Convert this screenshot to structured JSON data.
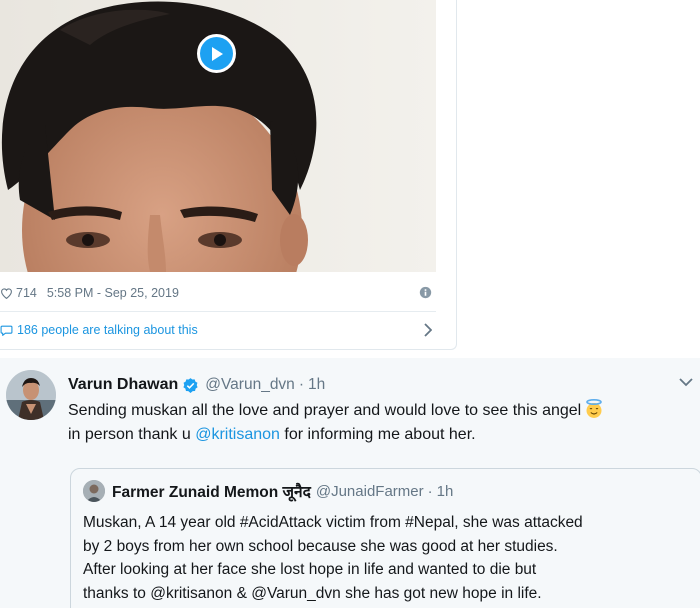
{
  "embed": {
    "likes": "714",
    "timestamp": "5:58 PM - Sep 25, 2019",
    "talking": "186 people are talking about this"
  },
  "tweet": {
    "display_name": "Varun Dhawan",
    "handle": "@Varun_dvn",
    "dot": "·",
    "time": "1h",
    "line1": "Sending muskan all the love and prayer and would love to see this angel",
    "line2_pre": "in person thank u ",
    "line2_mention": "@kritisanon",
    "line2_post": " for informing me about her."
  },
  "quote": {
    "display_name": "Farmer Zunaid Memon जूनैद",
    "handle": "@JunaidFarmer",
    "dot": "·",
    "time": "1h",
    "lines": [
      "Muskan, A 14 year old #AcidAttack victim from #Nepal, she was attacked",
      "by 2 boys from her own school because she was good at her studies.",
      "After looking at her face she lost hope in life and wanted to die but",
      "thanks to @kritisanon & @Varun_dvn she has got new hope in life."
    ]
  },
  "colors": {
    "accent": "#1da1f2",
    "link": "#1b95e0",
    "muted": "#657786",
    "text": "#14171a",
    "timeline_bg": "#f5f8fa"
  },
  "icons": [
    "play-icon",
    "heart-icon",
    "info-icon",
    "speech-bubble-icon",
    "chevron-right-icon",
    "verified-icon",
    "caret-down-icon",
    "angel-emoji-icon"
  ]
}
